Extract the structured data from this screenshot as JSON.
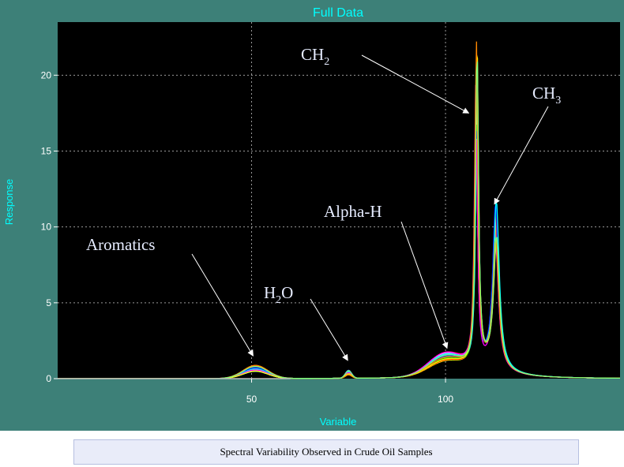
{
  "chart_data": {
    "type": "line",
    "title": "Full Data",
    "xlabel": "Variable",
    "ylabel": "Response",
    "xlim": [
      0,
      145
    ],
    "ylim": [
      0,
      23.5
    ],
    "xticks": [
      50,
      100
    ],
    "yticks": [
      0,
      5,
      10,
      15,
      20
    ],
    "grid": "dotted",
    "series_colors": [
      "#ff0000",
      "#00cc00",
      "#0000ff",
      "#00ffff",
      "#ff00ff",
      "#ffff00",
      "#ff8800",
      "#7fff7f",
      "#9999ff",
      "#ffffff"
    ],
    "peaks_approx": [
      {
        "x": 51,
        "y": 0.8
      },
      {
        "x": 75,
        "y": 0.5
      },
      {
        "x": 100,
        "y": 1.3
      },
      {
        "x": 108,
        "y": 22
      },
      {
        "x": 113,
        "y": 11
      }
    ],
    "annotations": [
      {
        "label": "CH",
        "sub": "2",
        "target_x": 106,
        "target_y": 17.5
      },
      {
        "label": "CH",
        "sub": "3",
        "target_x": 112.6,
        "target_y": 11.5
      },
      {
        "label": "Alpha-H",
        "target_x": 100.4,
        "target_y": 2.0
      },
      {
        "label": "Aromatics",
        "target_x": 50.4,
        "target_y": 1.5
      },
      {
        "label": "H",
        "sub": "2",
        "after": "O",
        "target_x": 74.8,
        "target_y": 1.2
      }
    ]
  },
  "caption": "Spectral Variability Observed in Crude Oil  Samples"
}
